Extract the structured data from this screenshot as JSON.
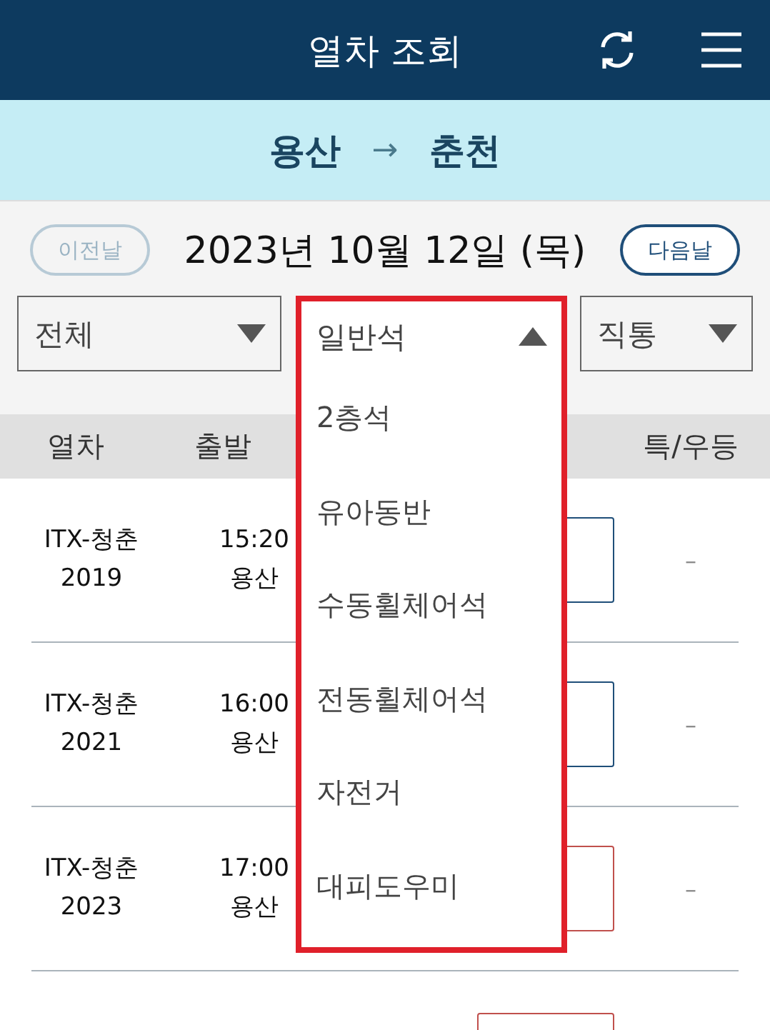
{
  "header": {
    "title": "열차 조회"
  },
  "route": {
    "from": "용산",
    "arrow": "→",
    "to": "춘천"
  },
  "date_nav": {
    "prev": {
      "label": "이전날",
      "disabled": true
    },
    "date": "2023년 10월 12일 (목)",
    "next": {
      "label": "다음날",
      "disabled": false
    }
  },
  "filters": [
    {
      "label": "전체",
      "expanded": false
    },
    {
      "label": "일반석",
      "expanded": true,
      "options": [
        "2층석",
        "유아동반",
        "수동휠체어석",
        "전동휠체어석",
        "자전거",
        "대피도우미"
      ]
    },
    {
      "label": "직통",
      "expanded": false
    }
  ],
  "table": {
    "columns": [
      "열차",
      "출발",
      null,
      null,
      "특/우등"
    ],
    "rows": [
      {
        "train": "ITX-청춘",
        "number": "2019",
        "time": "15:20",
        "station": "용산",
        "color": "#1f4e79",
        "premium": "–"
      },
      {
        "train": "ITX-청춘",
        "number": "2021",
        "time": "16:00",
        "station": "용산",
        "color": "#1f4e79",
        "premium": "–"
      },
      {
        "train": "ITX-청춘",
        "number": "2023",
        "time": "17:00",
        "station": "용산",
        "color": "#c0504d",
        "premium": "–"
      },
      {
        "color": "#c0504d"
      }
    ]
  }
}
